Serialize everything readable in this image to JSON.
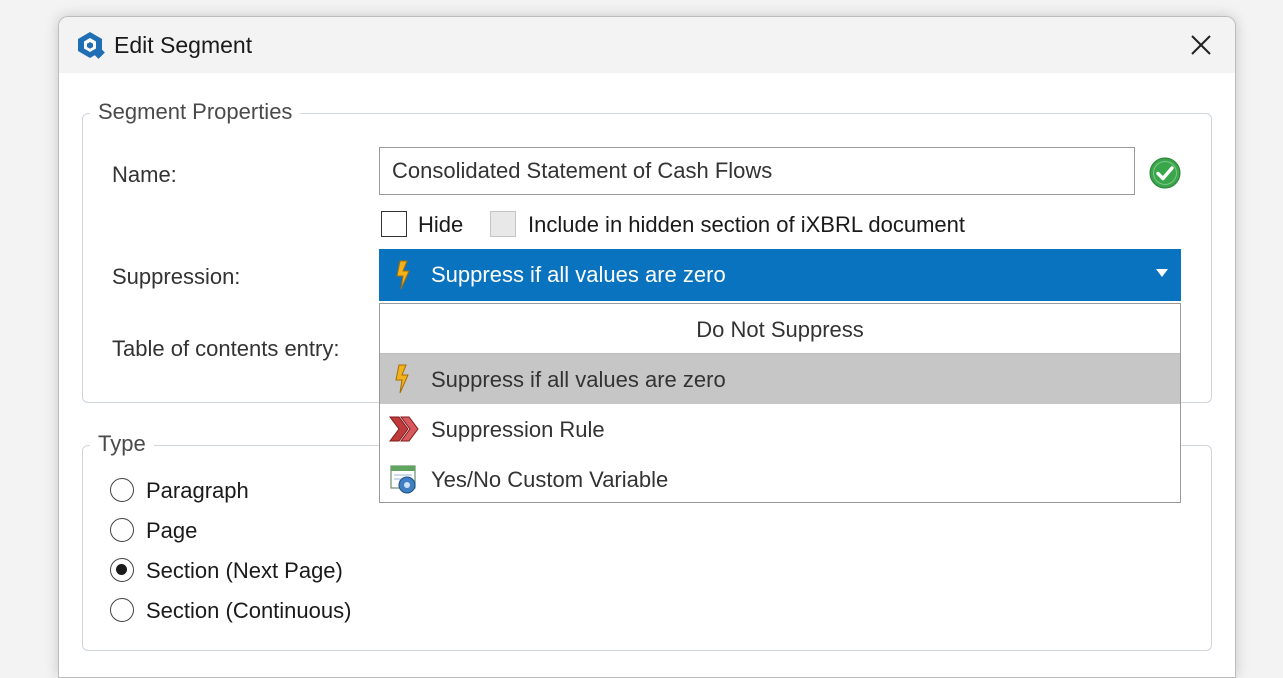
{
  "window": {
    "title": "Edit Segment",
    "app_icon": "app-logo-icon",
    "close_icon": "close-icon"
  },
  "segment_properties": {
    "legend": "Segment Properties",
    "name_label": "Name:",
    "name_value": "Consolidated Statement of Cash Flows",
    "name_valid_icon": "check-circle-icon",
    "hide_label": "Hide",
    "hide_checked": false,
    "include_hidden_label": "Include in hidden section of iXBRL document",
    "include_hidden_enabled": false,
    "suppression_label": "Suppression:",
    "suppression_selected": "Suppress if all values are zero",
    "toc_label": "Table of contents entry:"
  },
  "suppression_options": [
    {
      "label": "Do Not Suppress",
      "icon": ""
    },
    {
      "label": "Suppress if all values are zero",
      "icon": "lightning-bolt-icon",
      "selected": true
    },
    {
      "label": "Suppression Rule",
      "icon": "double-chevron-right-icon"
    },
    {
      "label": "Yes/No Custom Variable",
      "icon": "custom-variable-icon"
    }
  ],
  "type": {
    "legend": "Type",
    "options": [
      {
        "label": "Paragraph",
        "checked": false
      },
      {
        "label": "Page",
        "checked": false
      },
      {
        "label": "Section (Next Page)",
        "checked": true
      },
      {
        "label": "Section (Continuous)",
        "checked": false
      }
    ]
  },
  "colors": {
    "accent": "#0a73c0",
    "highlight": "#c6c6c6",
    "valid_green": "#3aa64a"
  }
}
